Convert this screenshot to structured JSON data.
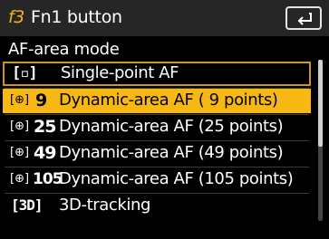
{
  "header": {
    "menu_code": "f3",
    "title": "Fn1 button"
  },
  "subtitle": "AF-area mode",
  "items": [
    {
      "icon_text": "[▫]",
      "number": "",
      "label": "Single-point AF"
    },
    {
      "icon_text": "[⊕]",
      "number": "9",
      "label": "Dynamic-area AF ( 9 points)"
    },
    {
      "icon_text": "[⊕]",
      "number": "25",
      "label": "Dynamic-area AF (25 points)"
    },
    {
      "icon_text": "[⊕]",
      "number": "49",
      "label": "Dynamic-area AF (49 points)"
    },
    {
      "icon_text": "[⊕]",
      "number": "105",
      "label": "Dynamic-area AF (105 points)"
    },
    {
      "icon_text": "[3D]",
      "number": "",
      "label": "3D-tracking"
    }
  ],
  "colors": {
    "accent": "#f7b814",
    "header_bg": "#262626",
    "background": "#000000"
  }
}
